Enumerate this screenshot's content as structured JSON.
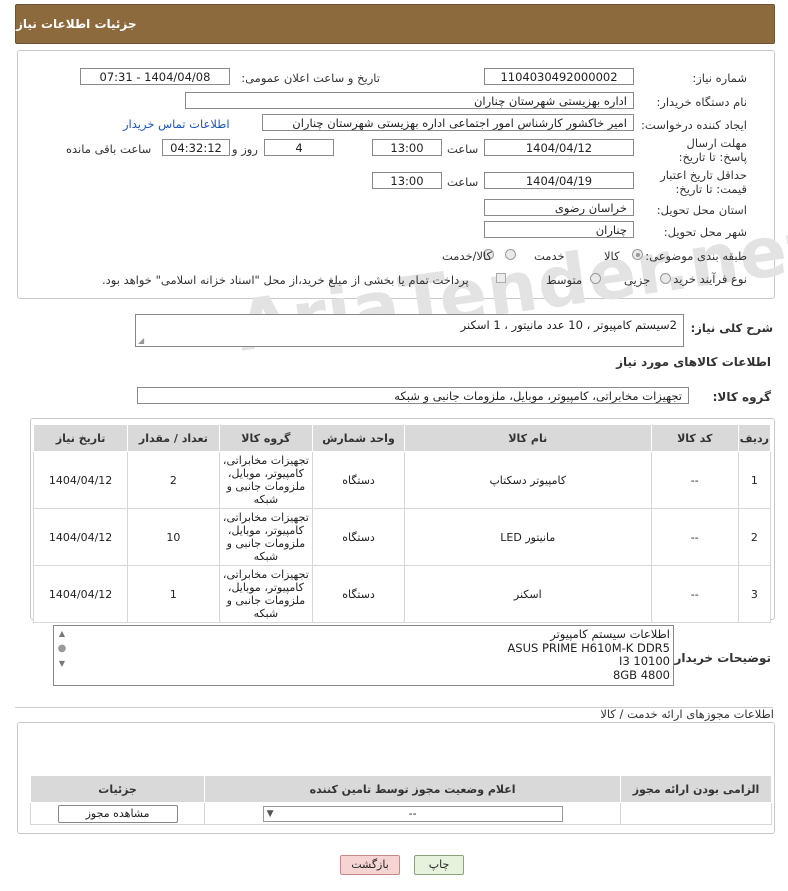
{
  "header": {
    "title": "جزئیات اطلاعات نیاز"
  },
  "watermark": "AriaTender.net",
  "form": {
    "need_number_label": "شماره نیاز:",
    "need_number": "1104030492000002",
    "announce_label": "تاریخ و ساعت اعلان عمومی:",
    "announce_value": "1404/04/08 - 07:31",
    "buyer_org_label": "نام دستگاه خریدار:",
    "buyer_org": "اداره بهزیستی شهرستان چناران",
    "creator_label": "ایجاد کننده درخواست:",
    "creator": "امیر خاکشور کارشناس امور اجتماعی اداره بهزیستی شهرستان چناران",
    "contact_link": "اطلاعات تماس خریدار",
    "deadline_label": "مهلت ارسال پاسخ: تا تاریخ:",
    "deadline_date": "1404/04/12",
    "time_label": "ساعت",
    "deadline_time": "13:00",
    "days_value": "4",
    "days_label": "روز و",
    "remaining_time": "04:32:12",
    "remaining_label": "ساعت باقی مانده",
    "validity_label": "حداقل تاریخ اعتبار قیمت: تا تاریخ:",
    "validity_date": "1404/04/19",
    "validity_time": "13:00",
    "province_label": "استان محل تحویل:",
    "province": "خراسان رضوی",
    "city_label": "شهر محل تحویل:",
    "city": "چناران",
    "category_label": "طبقه بندی موضوعی:",
    "category_options": [
      "کالا",
      "خدمت",
      "کالا/خدمت"
    ],
    "purchase_type_label": "نوع فرآیند خرید :",
    "purchase_options": [
      "جزیی",
      "متوسط"
    ],
    "payment_note": "پرداخت تمام یا بخشی از مبلغ خرید،از محل \"اسناد خزانه اسلامی\" خواهد بود."
  },
  "summary": {
    "label": "شرح کلی نیاز:",
    "text": "2سیستم کامپیوتر ، 10 عدد مانیتور ، 1 اسکنر"
  },
  "goods": {
    "section_title": "اطلاعات کالاهای مورد نیاز",
    "group_label": "گروه کالا:",
    "group_value": "تجهیزات مخابراتی، کامپیوتر، موبایل، ملزومات جانبی و شبکه",
    "columns": [
      "ردیف",
      "کد کالا",
      "نام کالا",
      "واحد شمارش",
      "گروه کالا",
      "تعداد / مقدار",
      "تاریخ نیاز"
    ],
    "rows": [
      {
        "index": "1",
        "code": "--",
        "name": "کامپیوتر دسکتاپ",
        "unit": "دستگاه",
        "group": "تجهیزات مخابراتی، کامپیوتر، موبایل، ملزومات جانبی و شبکه",
        "qty": "2",
        "date": "1404/04/12"
      },
      {
        "index": "2",
        "code": "--",
        "name": "مانیتور LED",
        "unit": "دستگاه",
        "group": "تجهیزات مخابراتی، کامپیوتر، موبایل، ملزومات جانبی و شبکه",
        "qty": "10",
        "date": "1404/04/12"
      },
      {
        "index": "3",
        "code": "--",
        "name": "اسکنر",
        "unit": "دستگاه",
        "group": "تجهیزات مخابراتی، کامپیوتر، موبایل، ملزومات جانبی و شبکه",
        "qty": "1",
        "date": "1404/04/12"
      }
    ]
  },
  "buyer_notes": {
    "label": "توضیحات خریدار:",
    "lines": [
      "اطلاعات سیستم کامپیوتر",
      "ASUS PRIME H610M-K DDR5",
      "I3 10100",
      "8GB  4800"
    ]
  },
  "licenses": {
    "title": "اطلاعات مجوزهای ارائه خدمت / کالا",
    "columns": [
      "الزامی بودن ارائه مجوز",
      "اعلام وضعیت مجوز توسط تامین کننده",
      "جزئیات"
    ],
    "select_value": "--",
    "view_button": "مشاهده مجوز"
  },
  "buttons": {
    "print": "چاپ",
    "back": "بازگشت"
  }
}
